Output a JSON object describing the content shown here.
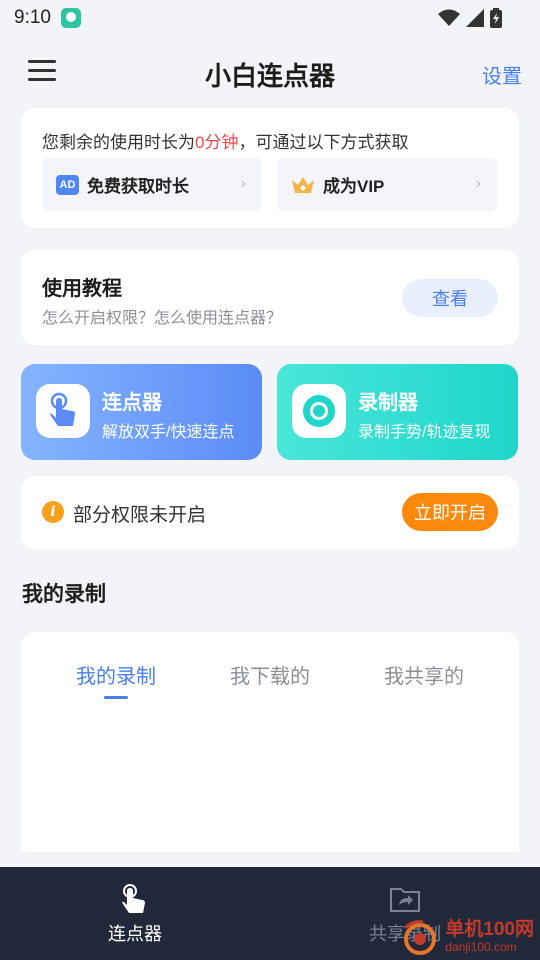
{
  "status": {
    "time": "9:10"
  },
  "header": {
    "title": "小白连点器",
    "settings_label": "设置"
  },
  "time_card": {
    "prefix": "您剩余的使用时长为",
    "remaining": "0分钟",
    "suffix": "，可通过以下方式获取",
    "ad_badge": "AD",
    "free_label": "免费获取时长",
    "vip_label": "成为VIP"
  },
  "tutorial": {
    "title": "使用教程",
    "subtitle": "怎么开启权限？怎么使用连点器？",
    "view_label": "查看"
  },
  "features": [
    {
      "title": "连点器",
      "subtitle": "解放双手/快速连点"
    },
    {
      "title": "录制器",
      "subtitle": "录制手势/轨迹复现"
    }
  ],
  "permission": {
    "text": "部分权限未开启",
    "button_label": "立即开启",
    "info_glyph": "i"
  },
  "recordings": {
    "section_title": "我的录制",
    "tabs": [
      "我的录制",
      "我下载的",
      "我共享的"
    ],
    "active_tab": 0
  },
  "bottom_nav": {
    "items": [
      {
        "label": "连点器",
        "active": true
      },
      {
        "label": "共享录制",
        "active": false
      }
    ]
  },
  "watermark": {
    "name": "单机100网",
    "url": "danji100.com"
  },
  "colors": {
    "accent": "#4a7ff0",
    "highlight": "#f0494a",
    "orange": "#fb8a0c",
    "nav_bg": "#21283a"
  }
}
